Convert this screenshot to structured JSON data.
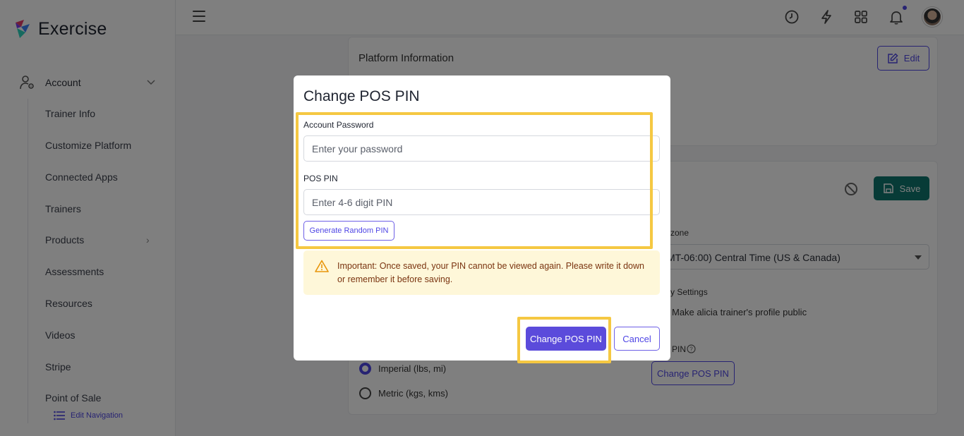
{
  "app": {
    "name": "Exercise"
  },
  "sidebar": {
    "account_label": "Account",
    "items": [
      {
        "label": "Trainer Info"
      },
      {
        "label": "Customize Platform"
      },
      {
        "label": "Connected Apps"
      },
      {
        "label": "Trainers"
      },
      {
        "label": "Products"
      },
      {
        "label": "Assessments"
      },
      {
        "label": "Resources"
      },
      {
        "label": "Videos"
      },
      {
        "label": "Stripe"
      },
      {
        "label": "Point of Sale"
      }
    ],
    "edit_navigation": "Edit Navigation"
  },
  "background": {
    "section_title": "Platform Information",
    "edit_label": "Edit",
    "save_label": "Save",
    "timezone_label": "zone",
    "timezone_value": "MT-06:00) Central Time (US & Canada)",
    "privacy_label": "y Settings",
    "public_profile": "Make alicia trainer's profile public",
    "pin_label": "PIN",
    "change_pos_pin": "Change POS PIN",
    "units": [
      {
        "label": "Imperial (lbs, mi)",
        "selected": true
      },
      {
        "label": "Metric (kgs, kms)",
        "selected": false
      }
    ]
  },
  "modal": {
    "title": "Change POS PIN",
    "password_label": "Account Password",
    "password_placeholder": "Enter your password",
    "pin_label": "POS PIN",
    "pin_placeholder": "Enter 4-6 digit PIN",
    "generate_label": "Generate Random PIN",
    "warning": "Important: Once saved, your PIN cannot be viewed again. Please write it down or remember it before saving.",
    "primary_label": "Change POS PIN",
    "cancel_label": "Cancel"
  },
  "colors": {
    "accent": "#4f46e5",
    "highlight": "#f5c842",
    "save": "#0f766e",
    "warning_bg": "#fef7d9"
  }
}
